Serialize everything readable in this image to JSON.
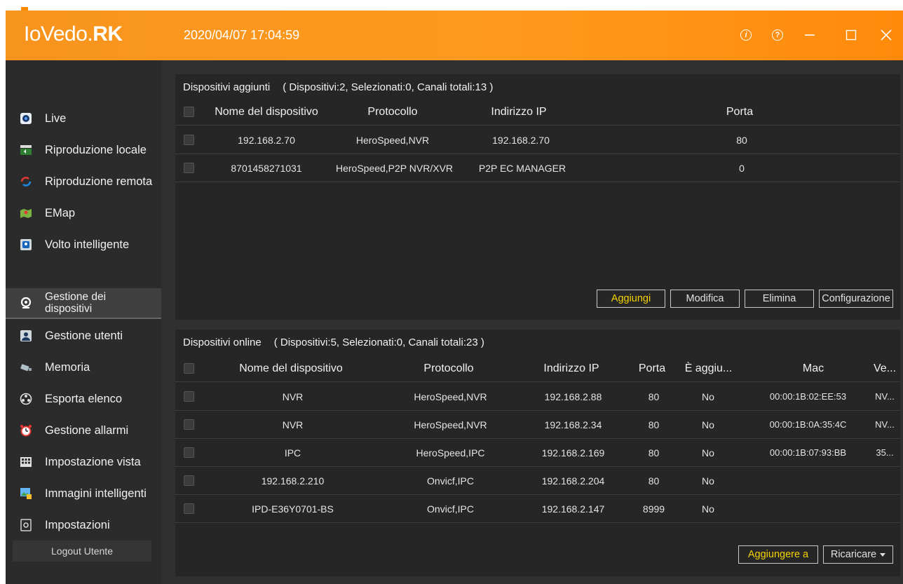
{
  "app": {
    "logo_light": "IoVedo.",
    "logo_bold": "RK",
    "datetime": "2020/04/07 17:04:59"
  },
  "window_controls": {
    "info_icon": "info-icon",
    "help_icon": "help-icon",
    "minimize_icon": "minimize-icon",
    "maximize_icon": "maximize-icon",
    "close_icon": "close-icon"
  },
  "sidebar": {
    "items": [
      {
        "label": "Live",
        "icon": "live-camera-icon"
      },
      {
        "label": "Riproduzione locale",
        "icon": "local-playback-icon"
      },
      {
        "label": "Riproduzione remota",
        "icon": "remote-playback-icon"
      },
      {
        "label": "EMap",
        "icon": "emap-icon"
      },
      {
        "label": "Volto intelligente",
        "icon": "face-recognition-icon"
      },
      {
        "label": "Gestione dei dispositivi",
        "icon": "device-management-icon"
      },
      {
        "label": "Gestione utenti",
        "icon": "user-management-icon"
      },
      {
        "label": "Memoria",
        "icon": "storage-icon"
      },
      {
        "label": "Esporta elenco",
        "icon": "export-list-icon"
      },
      {
        "label": "Gestione allarmi",
        "icon": "alarm-clock-icon"
      },
      {
        "label": "Impostazione vista",
        "icon": "view-layout-icon"
      },
      {
        "label": "Immagini intelligenti",
        "icon": "smart-images-icon"
      },
      {
        "label": "Impostazioni",
        "icon": "settings-icon"
      }
    ],
    "active": "Gestione dei dispositivi",
    "logout": "Logout Utente"
  },
  "added_devices": {
    "title": "Dispositivi aggiunti",
    "summary": "( Dispositivi:2, Selezionati:0, Canali totali:13 )",
    "columns": [
      "Nome del dispositivo",
      "Protocollo",
      "Indirizzo IP",
      "Porta"
    ],
    "rows": [
      {
        "name": "192.168.2.70",
        "protocol": "HeroSpeed,NVR",
        "ip": "192.168.2.70",
        "port": "80"
      },
      {
        "name": "8701458271031",
        "protocol": "HeroSpeed,P2P NVR/XVR",
        "ip": "P2P EC MANAGER",
        "port": "0"
      }
    ],
    "buttons": {
      "add": "Aggiungi",
      "edit": "Modifica",
      "delete": "Elimina",
      "config": "Configurazione"
    }
  },
  "online_devices": {
    "title": "Dispositivi online",
    "summary": "( Dispositivi:5, Selezionati:0, Canali totali:23 )",
    "columns": [
      "Nome del dispositivo",
      "Protocollo",
      "Indirizzo IP",
      "Porta",
      "È aggiu...",
      "Mac",
      "Ve..."
    ],
    "rows": [
      {
        "name": "NVR",
        "protocol": "HeroSpeed,NVR",
        "ip": "192.168.2.88",
        "port": "80",
        "added": "No",
        "mac": "00:00:1B:02:EE:53",
        "version": "NV..."
      },
      {
        "name": "NVR",
        "protocol": "HeroSpeed,NVR",
        "ip": "192.168.2.34",
        "port": "80",
        "added": "No",
        "mac": "00:00:1B:0A:35:4C",
        "version": "NV..."
      },
      {
        "name": "IPC",
        "protocol": "HeroSpeed,IPC",
        "ip": "192.168.2.169",
        "port": "80",
        "added": "No",
        "mac": "00:00:1B:07:93:BB",
        "version": "35..."
      },
      {
        "name": "192.168.2.210",
        "protocol": "Onvicf,IPC",
        "ip": "192.168.2.204",
        "port": "80",
        "added": "No",
        "mac": "",
        "version": ""
      },
      {
        "name": "IPD-E36Y0701-BS",
        "protocol": "Onvicf,IPC",
        "ip": "192.168.2.147",
        "port": "8999",
        "added": "No",
        "mac": "",
        "version": ""
      }
    ],
    "buttons": {
      "add": "Aggiungere a",
      "reload": "Ricaricare"
    }
  },
  "colors": {
    "titlebar": "#f7941d",
    "background": "#303030",
    "panel": "#262626",
    "sidebar": "#2b2b2b",
    "accent_text": "#f5d200"
  }
}
